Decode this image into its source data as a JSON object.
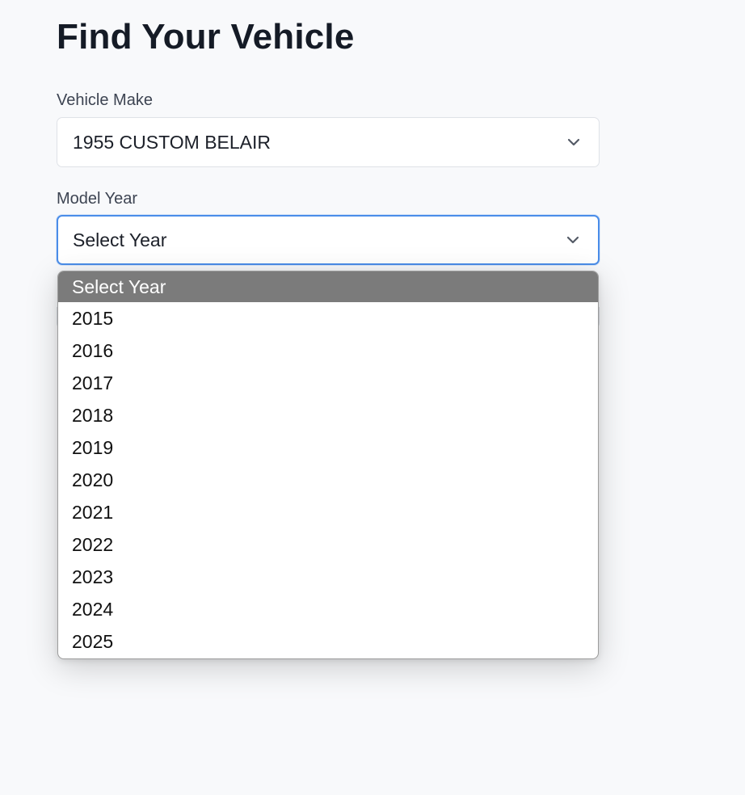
{
  "page": {
    "title": "Find Your Vehicle"
  },
  "make_field": {
    "label": "Vehicle Make",
    "value": "1955 CUSTOM BELAIR"
  },
  "year_field": {
    "label": "Model Year",
    "value": "Select Year",
    "options": [
      "Select Year",
      "2015",
      "2016",
      "2017",
      "2018",
      "2019",
      "2020",
      "2021",
      "2022",
      "2023",
      "2024",
      "2025"
    ],
    "selected_option": "Select Year"
  },
  "icons": {
    "select_chevron": "chevron-down-icon"
  },
  "colors": {
    "focus_border": "#4a8de9",
    "selected_option_bg": "#7b7b7b",
    "title_text": "#151b26"
  }
}
